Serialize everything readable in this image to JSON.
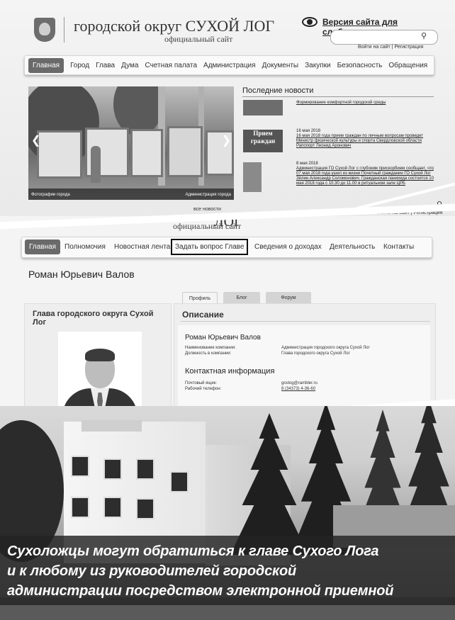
{
  "header": {
    "title": "городской округ СУХОЙ ЛОГ",
    "subtitle": "официальный сайт",
    "low_vision_link": "Версия сайта для слабовидящих",
    "login_links": "Войти на сайт | Регистрация",
    "search_placeholder": ""
  },
  "nav1": {
    "items": [
      "Главная",
      "Город",
      "Глава",
      "Дума",
      "Счетная палата",
      "Администрация",
      "Документы",
      "Закупки",
      "Безопасность",
      "Обращения"
    ]
  },
  "slider": {
    "caption_left": "Фотографии города",
    "caption_right": "Администрация города"
  },
  "news": {
    "title": "Последние новости",
    "items": [
      {
        "date": "",
        "text": "Формирование комфортной городской среды"
      },
      {
        "date": "16 мая 2018",
        "text": "16 мая 2018 года прием граждан по личным вопросам проведет Министр физической культуры и спорта Свердловской области Рапопорт Леонид Аронович",
        "thumb_text": "Прием граждан"
      },
      {
        "date": "8 мая 2018",
        "text": "Администрация ГО Сухой Лог с глубоким прискорбием сообщает, что 07 мая 2018 года ушел из жизни Почетный гражданин ГО Сухой Лог Зёлин Александр Соломонович. Гражданская панихида состоится 10 мая 2018 года с 10.30 до 11.00 в ритуальном зале ЦРБ"
      }
    ],
    "all_news": "все новости"
  },
  "header2": {
    "title_fragment": "ЛОГ",
    "subtitle": "официальный сайт"
  },
  "nav2": {
    "items": [
      "Главная",
      "Полномочия",
      "Новостная лента",
      "Задать вопрос Главе",
      "Сведения о доходах",
      "Деятельность",
      "Контакты"
    ]
  },
  "profile": {
    "name": "Роман Юрьевич Валов",
    "tabs": [
      "Профиль",
      "Блог",
      "Форум"
    ],
    "card_title": "Глава городского округа Сухой Лог",
    "description_title": "Описание",
    "desc_name": "Роман Юрьевич Валов",
    "company_label": "Наименование компании:",
    "company_value": "Администрация городского округа Сухой Лог",
    "position_label": "Должность в компании:",
    "position_value": "Глава городского округа Сухой Лог",
    "contact_title": "Контактная информация",
    "mail_label": "Почтовый ящик:",
    "mail_value": "goslog@rambler.ru",
    "phone_label": "Рабочий телефон:",
    "phone_value": "8 (34373) 4-36-60"
  },
  "caption": {
    "lines": [
      "Сухоложцы могут обратиться к главе Сухого Лога",
      "и к любому из руководителей городской",
      "администрации посредством электронной приемной"
    ]
  }
}
